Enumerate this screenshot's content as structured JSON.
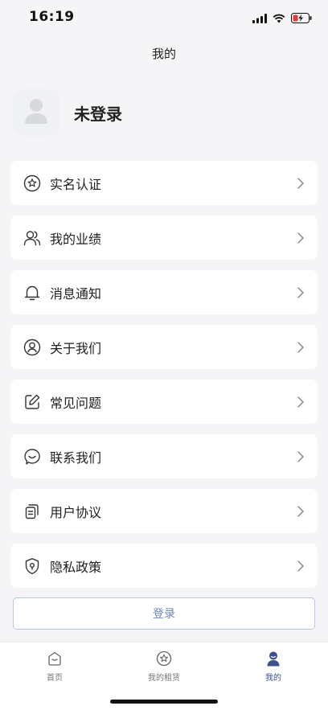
{
  "status_bar": {
    "time": "16:19"
  },
  "header": {
    "title": "我的"
  },
  "profile": {
    "name": "未登录"
  },
  "menu": {
    "items": [
      {
        "label": "实名认证",
        "icon": "star-badge-icon"
      },
      {
        "label": "我的业绩",
        "icon": "users-icon"
      },
      {
        "label": "消息通知",
        "icon": "bell-icon"
      },
      {
        "label": "关于我们",
        "icon": "user-circle-icon"
      },
      {
        "label": "常见问题",
        "icon": "edit-icon"
      },
      {
        "label": "联系我们",
        "icon": "chat-icon"
      },
      {
        "label": "用户协议",
        "icon": "document-icon"
      },
      {
        "label": "隐私政策",
        "icon": "shield-icon"
      }
    ]
  },
  "login": {
    "label": "登录"
  },
  "tab_bar": {
    "tabs": [
      {
        "label": "首页",
        "icon": "home-icon"
      },
      {
        "label": "我的租赁",
        "icon": "star-icon"
      },
      {
        "label": "我的",
        "icon": "profile-icon",
        "active": true
      }
    ]
  },
  "colors": {
    "accent": "#3d4f8f",
    "login_text": "#6f86c0",
    "background": "#f5f5f7"
  }
}
